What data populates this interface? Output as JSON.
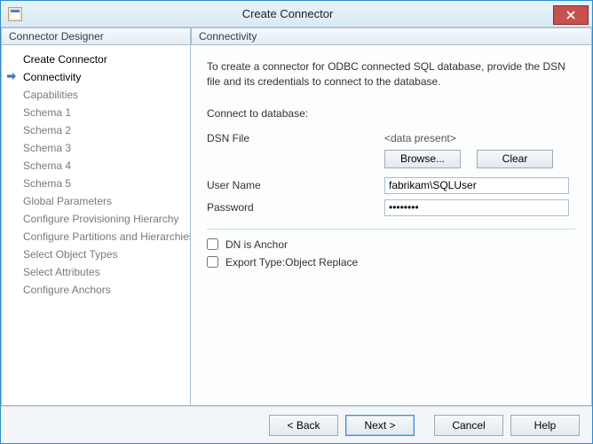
{
  "window": {
    "title": "Create Connector"
  },
  "panels": {
    "left_title": "Connector Designer",
    "right_title": "Connectivity"
  },
  "nav": {
    "items": [
      {
        "label": "Create Connector",
        "state": "done"
      },
      {
        "label": "Connectivity",
        "state": "current"
      },
      {
        "label": "Capabilities",
        "state": "pending"
      },
      {
        "label": "Schema 1",
        "state": "pending"
      },
      {
        "label": "Schema 2",
        "state": "pending"
      },
      {
        "label": "Schema 3",
        "state": "pending"
      },
      {
        "label": "Schema 4",
        "state": "pending"
      },
      {
        "label": "Schema 5",
        "state": "pending"
      },
      {
        "label": "Global Parameters",
        "state": "pending"
      },
      {
        "label": "Configure Provisioning Hierarchy",
        "state": "pending"
      },
      {
        "label": "Configure Partitions and Hierarchies",
        "state": "pending"
      },
      {
        "label": "Select Object Types",
        "state": "pending"
      },
      {
        "label": "Select Attributes",
        "state": "pending"
      },
      {
        "label": "Configure Anchors",
        "state": "pending"
      }
    ]
  },
  "main": {
    "intro": "To create a connector for ODBC connected SQL database, provide the DSN file and its credentials to connect to the database.",
    "section_label": "Connect to database:",
    "dsn_label": "DSN File",
    "dsn_value": "<data present>",
    "browse": "Browse...",
    "clear": "Clear",
    "username_label": "User Name",
    "username_value": "fabrikam\\SQLUser",
    "password_label": "Password",
    "password_value": "••••••••",
    "dn_anchor_label": "DN is Anchor",
    "export_type_label": "Export Type:Object Replace"
  },
  "footer": {
    "back": "<  Back",
    "next": "Next  >",
    "cancel": "Cancel",
    "help": "Help"
  }
}
